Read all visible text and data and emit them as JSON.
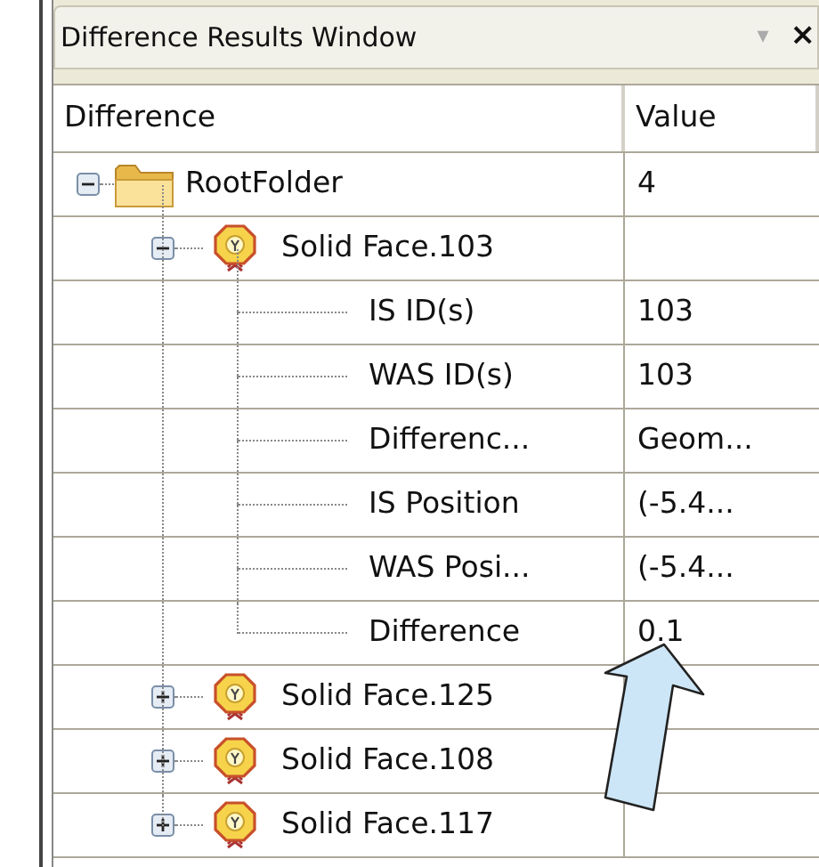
{
  "window": {
    "title": "Difference Results Window",
    "menu_glyph": "▾",
    "close_glyph": "×"
  },
  "table": {
    "columns": [
      "Difference",
      "Value"
    ],
    "tree": [
      {
        "kind": "folder",
        "label": "RootFolder",
        "value": "4",
        "expanded": true,
        "children": [
          {
            "kind": "face",
            "label": "Solid Face.103",
            "expanded": true,
            "children": [
              {
                "kind": "property",
                "label": "IS ID(s)",
                "value": "103"
              },
              {
                "kind": "property",
                "label": "WAS ID(s)",
                "value": "103"
              },
              {
                "kind": "property",
                "label": "Differenc...",
                "value": "Geom..."
              },
              {
                "kind": "property",
                "label": "IS Position",
                "value": "(-5.4..."
              },
              {
                "kind": "property",
                "label": "WAS Posi...",
                "value": "(-5.4..."
              },
              {
                "kind": "property",
                "label": "Difference",
                "value": "0.1"
              }
            ]
          },
          {
            "kind": "face",
            "label": "Solid Face.125",
            "expanded": false
          },
          {
            "kind": "face",
            "label": "Solid Face.108",
            "expanded": false
          },
          {
            "kind": "face",
            "label": "Solid Face.117",
            "expanded": false
          }
        ]
      }
    ]
  }
}
